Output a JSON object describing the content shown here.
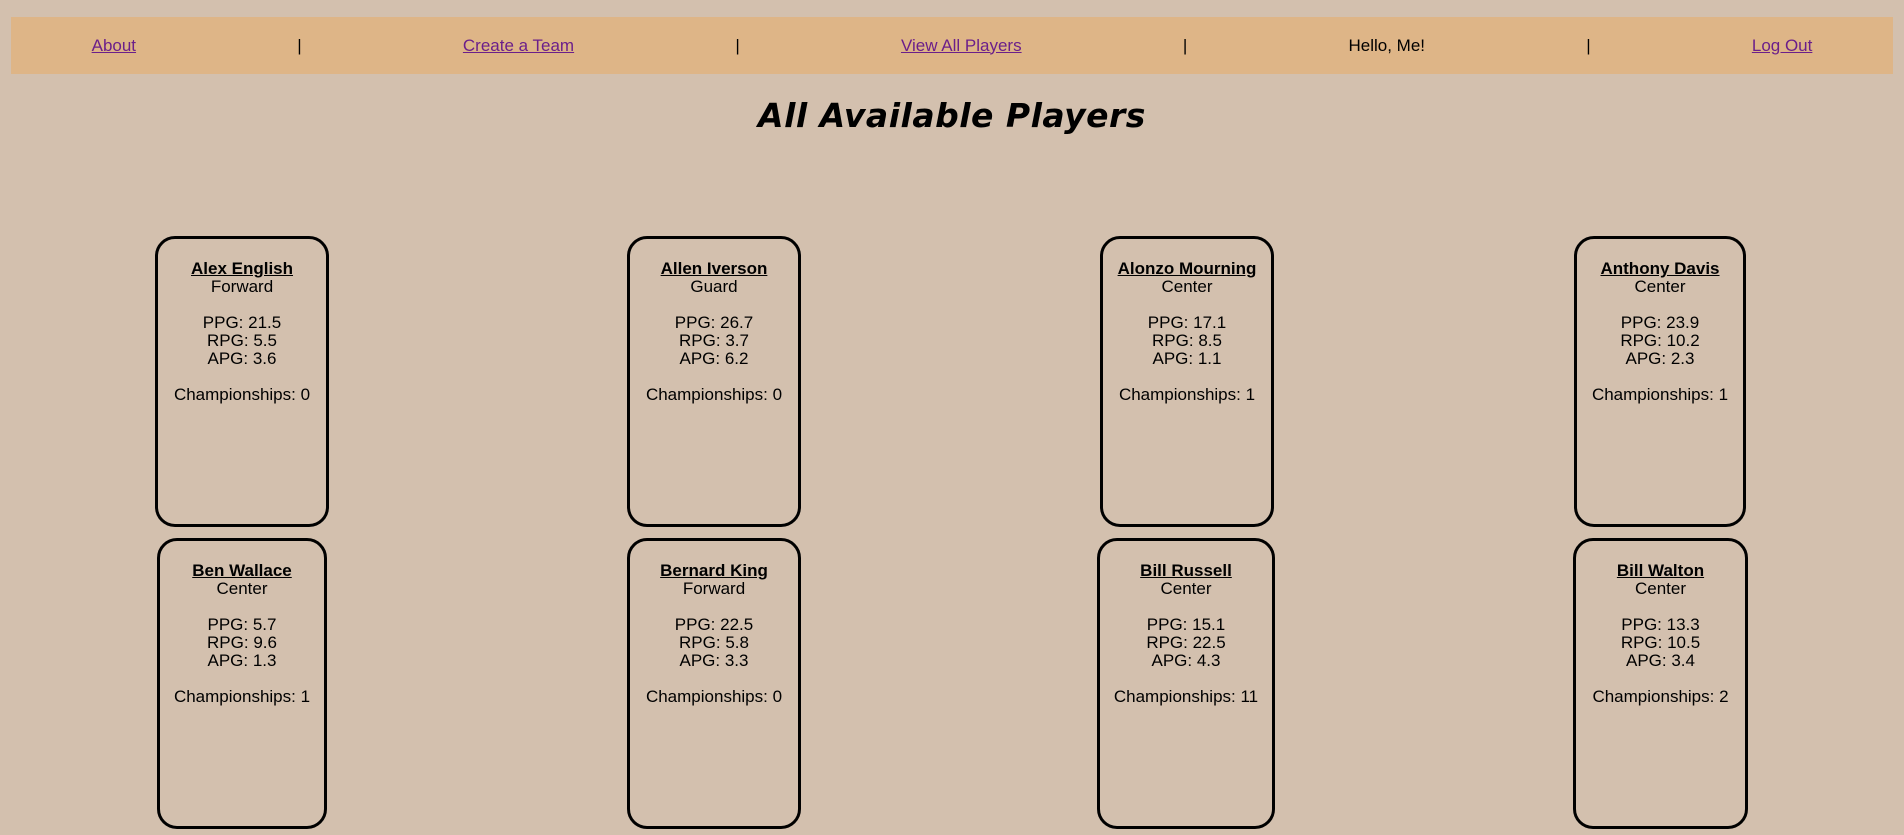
{
  "nav": {
    "about": "About",
    "create_team": "Create a Team",
    "view_players": "View All Players",
    "greeting": "Hello, Me!",
    "logout": "Log Out",
    "separator": "|"
  },
  "page_title": "All Available Players",
  "players": [
    {
      "name": "Alex English",
      "position": "Forward",
      "ppg": "PPG: 21.5",
      "rpg": "RPG: 5.5",
      "apg": "APG: 3.6",
      "championships": "Championships: 0"
    },
    {
      "name": "Allen Iverson",
      "position": "Guard",
      "ppg": "PPG: 26.7",
      "rpg": "RPG: 3.7",
      "apg": "APG: 6.2",
      "championships": "Championships: 0"
    },
    {
      "name": "Alonzo Mourning",
      "position": "Center",
      "ppg": "PPG: 17.1",
      "rpg": "RPG: 8.5",
      "apg": "APG: 1.1",
      "championships": "Championships: 1"
    },
    {
      "name": "Anthony Davis",
      "position": "Center",
      "ppg": "PPG: 23.9",
      "rpg": "RPG: 10.2",
      "apg": "APG: 2.3",
      "championships": "Championships: 1"
    },
    {
      "name": "Ben Wallace",
      "position": "Center",
      "ppg": "PPG: 5.7",
      "rpg": "RPG: 9.6",
      "apg": "APG: 1.3",
      "championships": "Championships: 1"
    },
    {
      "name": "Bernard King",
      "position": "Forward",
      "ppg": "PPG: 22.5",
      "rpg": "RPG: 5.8",
      "apg": "APG: 3.3",
      "championships": "Championships: 0"
    },
    {
      "name": "Bill Russell",
      "position": "Center",
      "ppg": "PPG: 15.1",
      "rpg": "RPG: 22.5",
      "apg": "APG: 4.3",
      "championships": "Championships: 11"
    },
    {
      "name": "Bill Walton",
      "position": "Center",
      "ppg": "PPG: 13.3",
      "rpg": "RPG: 10.5",
      "apg": "APG: 3.4",
      "championships": "Championships: 2"
    }
  ]
}
